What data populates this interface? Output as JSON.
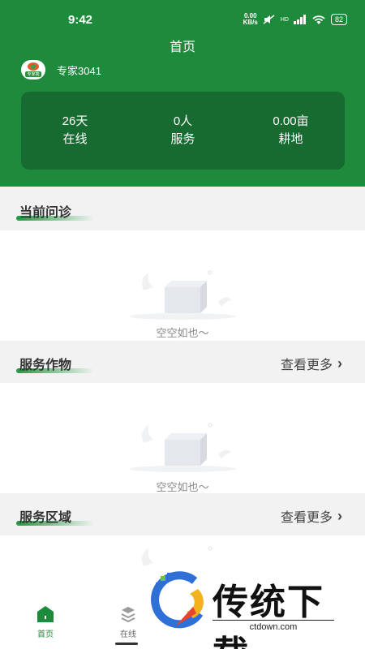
{
  "status": {
    "time": "9:42",
    "net_top": "0.00",
    "net_bottom": "KB/s",
    "hd": "HD",
    "battery": "82"
  },
  "header": {
    "title": "首页"
  },
  "user": {
    "name": "专家3041",
    "avatar_tag": "专家端"
  },
  "stats": [
    {
      "value": "26天",
      "label": "在线"
    },
    {
      "value": "0人",
      "label": "服务"
    },
    {
      "value": "0.00亩",
      "label": "耕地"
    }
  ],
  "sections": {
    "consult": {
      "title": "当前问诊",
      "empty": "空空如也～"
    },
    "crops": {
      "title": "服务作物",
      "more": "查看更多",
      "empty": "空空如也～"
    },
    "region": {
      "title": "服务区域",
      "more": "查看更多"
    }
  },
  "tabs": [
    {
      "label": "首页",
      "icon": "home-icon"
    },
    {
      "label": "在线",
      "icon": "layers-icon"
    }
  ],
  "watermark": {
    "text": "传统下载",
    "url": "ctdown.com"
  },
  "colors": {
    "brand": "#1e8a3c",
    "brand_dark": "#176b30"
  }
}
